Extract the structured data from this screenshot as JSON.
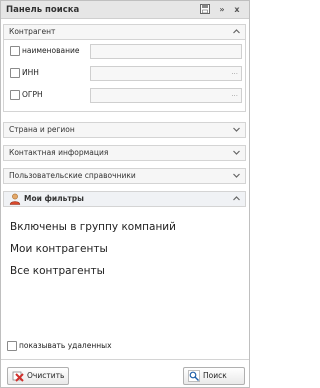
{
  "panel": {
    "title": "Панель поиска",
    "pin_icon": "save-icon",
    "close_label": "x",
    "more_label": "»"
  },
  "contractor": {
    "header": "Контрагент",
    "fields": [
      {
        "label": "наименование",
        "value": "",
        "has_picker": false
      },
      {
        "label": "ИНН",
        "value": "",
        "has_picker": true,
        "picker_label": "..."
      },
      {
        "label": "ОГРН",
        "value": "",
        "has_picker": true,
        "picker_label": "..."
      }
    ]
  },
  "sections": [
    {
      "label": "Страна и регион"
    },
    {
      "label": "Контактная информация"
    },
    {
      "label": "Пользовательские справочники"
    }
  ],
  "filters": {
    "header": "Мои фильтры",
    "items": [
      "Включены в группу компаний",
      "Мои контрагенты",
      "Все контрагенты"
    ]
  },
  "show_deleted_label": "показывать удаленных",
  "buttons": {
    "clear": "Очистить",
    "search": "Поиск"
  },
  "colors": {
    "clear_icon": "#d0312d",
    "accent": "#1f5fa8"
  }
}
